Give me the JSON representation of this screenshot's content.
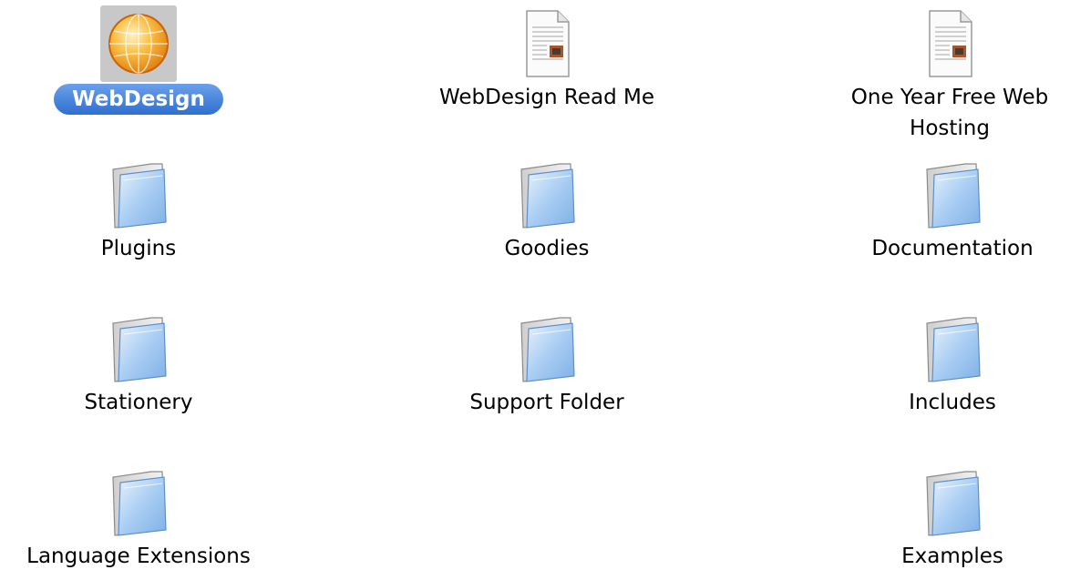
{
  "window": {
    "items": [
      {
        "label": "WebDesign",
        "icon": "globe-app-icon",
        "selected": true
      },
      {
        "label": "WebDesign Read Me",
        "icon": "document-icon"
      },
      {
        "label": "One Year Free Web Hosting",
        "icon": "document-icon"
      },
      {
        "label": "Plugins",
        "icon": "folder-icon"
      },
      {
        "label": "Goodies",
        "icon": "folder-icon"
      },
      {
        "label": "Documentation",
        "icon": "folder-icon"
      },
      {
        "label": "Stationery",
        "icon": "folder-icon"
      },
      {
        "label": "Support Folder",
        "icon": "folder-icon"
      },
      {
        "label": "Includes",
        "icon": "folder-icon"
      },
      {
        "label": "Language Extensions",
        "icon": "folder-icon"
      },
      {
        "label": "Examples",
        "icon": "folder-icon"
      }
    ],
    "colors": {
      "selection": "#3a7bd5",
      "icon_highlight": "#c8c8c8",
      "folder_blue": "#9cc4f0",
      "globe_orange": "#f5a623"
    }
  }
}
